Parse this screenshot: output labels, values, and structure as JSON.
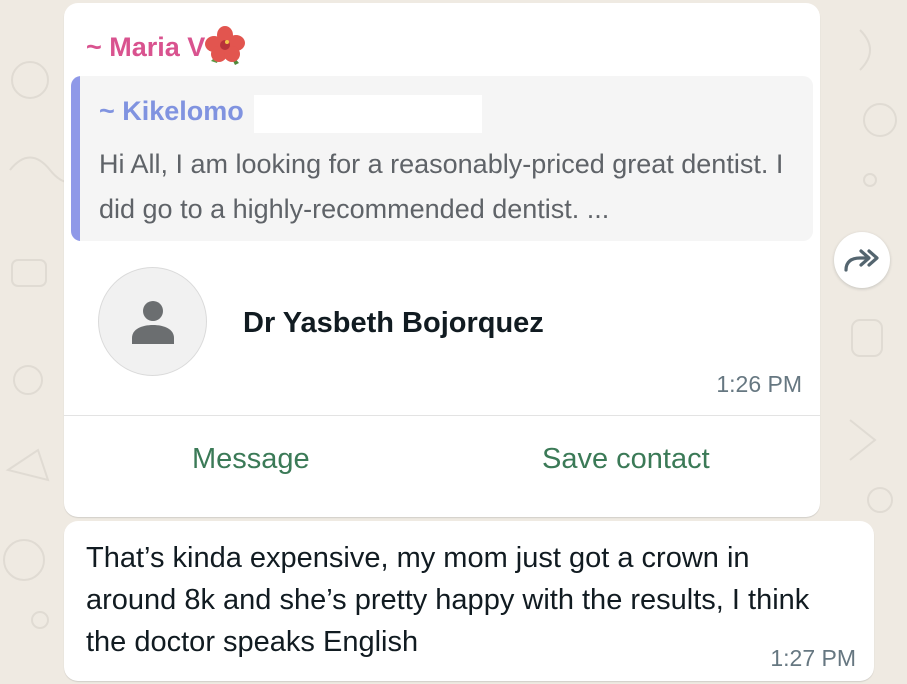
{
  "colors": {
    "background": "#efeae2",
    "sender_name": "#d9538f",
    "quote_author": "#8093e0",
    "quote_bar": "#8f99e8",
    "action_text": "#3b7a57",
    "timestamp": "#667781"
  },
  "contact_card_message": {
    "sender": "~ Maria V",
    "sender_emoji": "hibiscus-icon",
    "quoted": {
      "author": "~ Kikelomo",
      "text": "Hi All, I am looking for a reasonably-priced great dentist. I did go to a highly-recommended dentist. ..."
    },
    "contact": {
      "avatar_icon": "person-icon",
      "name": "Dr Yasbeth Bojorquez"
    },
    "time": "1:26 PM",
    "actions": {
      "message": "Message",
      "save_contact": "Save contact"
    },
    "forward_icon": "forward-icon"
  },
  "reply_message": {
    "text": "That’s kinda expensive, my mom just got a crown in around 8k and she’s pretty happy with the results, I think the doctor speaks English",
    "time": "1:27 PM"
  }
}
